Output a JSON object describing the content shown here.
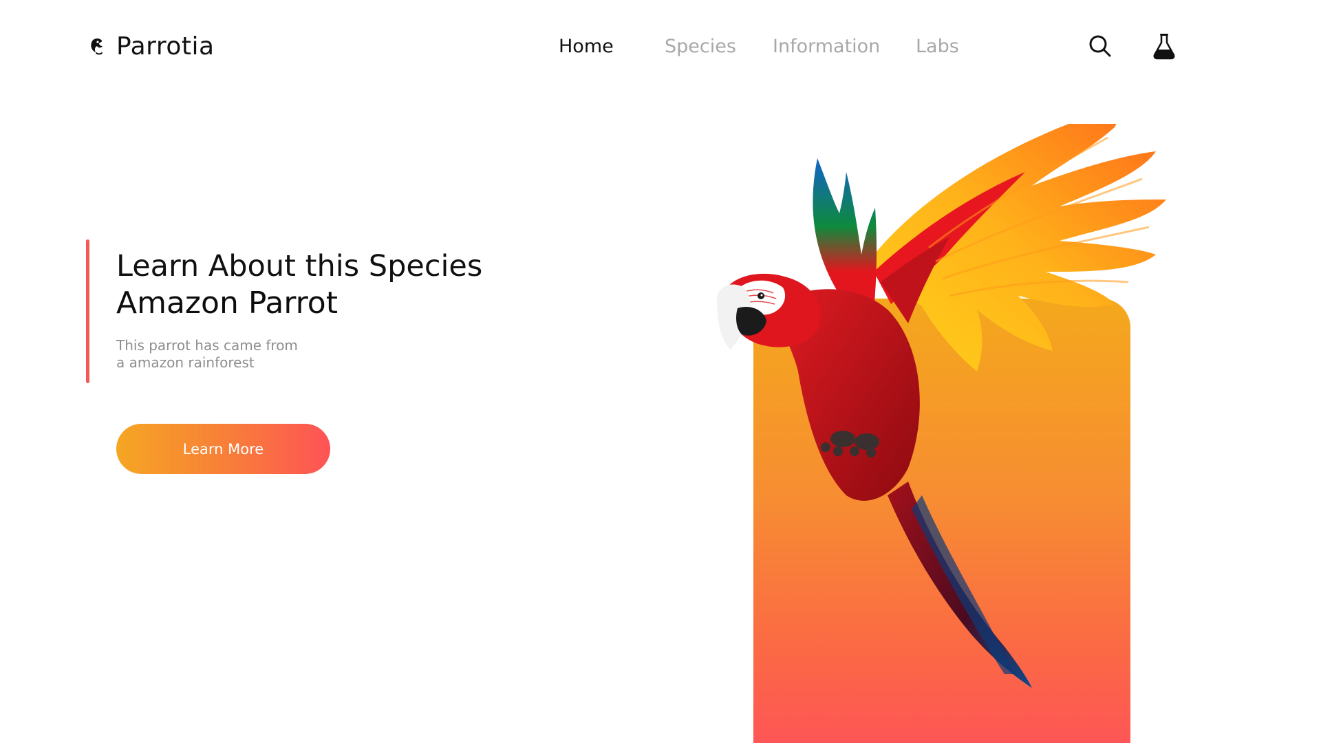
{
  "brand": {
    "name": "Parrotia",
    "logo_icon": "parrot-head-icon"
  },
  "nav": {
    "items": [
      {
        "label": "Home",
        "active": true
      },
      {
        "label": "Species",
        "active": false
      },
      {
        "label": "Information",
        "active": false
      },
      {
        "label": "Labs",
        "active": false
      }
    ]
  },
  "header_icons": {
    "search": "search-icon",
    "labs": "flask-icon"
  },
  "hero": {
    "heading": "Learn About this Species",
    "species": "Amazon Parrot",
    "description_line1": "This parrot has came from",
    "description_line2": "a amazon rainforest",
    "cta_label": "Learn More"
  },
  "colors": {
    "accent": "#f25a5a",
    "gradient_start": "#f5a623",
    "gradient_end": "#fe5356",
    "nav_active": "#111111",
    "nav_inactive": "#a8a8a8"
  },
  "illustration": "macaw-parrot-illustration"
}
